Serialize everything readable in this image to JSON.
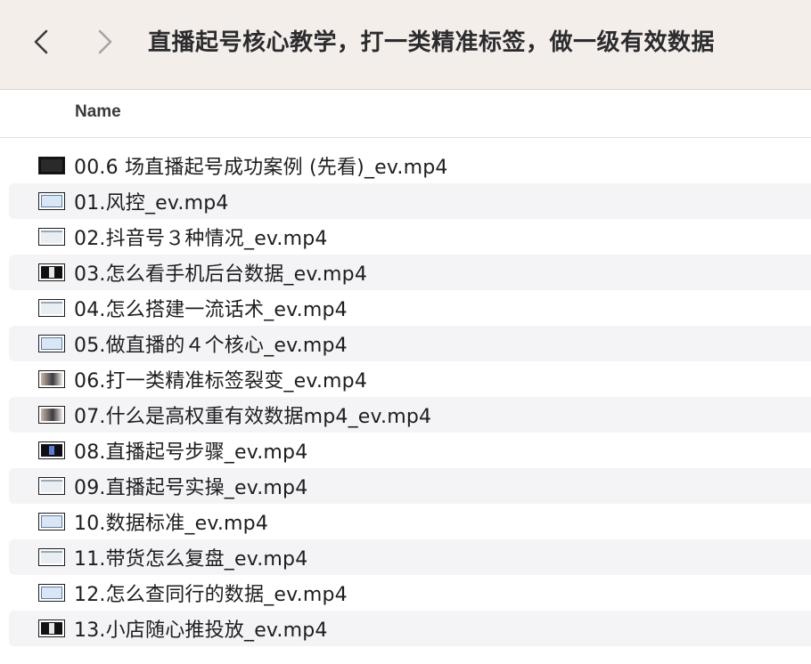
{
  "window": {
    "title": "直播起号核心教学，打一类精准标签，做一级有效数据",
    "back_icon": "chevron-left-icon",
    "forward_icon": "chevron-right-icon"
  },
  "columns": {
    "name": "Name"
  },
  "files": [
    {
      "name": "00.6 场直播起号成功案例 (先看)_ev.mp4",
      "thumb": "dark"
    },
    {
      "name": "01.风控_ev.mp4",
      "thumb": "blue"
    },
    {
      "name": "02.抖音号３种情况_ev.mp4",
      "thumb": "light"
    },
    {
      "name": "03.怎么看手机后台数据_ev.mp4",
      "thumb": "center"
    },
    {
      "name": "04.怎么搭建一流话术_ev.mp4",
      "thumb": "light"
    },
    {
      "name": "05.做直播的４个核心_ev.mp4",
      "thumb": "blue"
    },
    {
      "name": "06.打一类精准标签裂变_ev.mp4",
      "thumb": "person"
    },
    {
      "name": "07.什么是高权重有效数据mp4_ev.mp4",
      "thumb": "person"
    },
    {
      "name": "08.直播起号步骤_ev.mp4",
      "thumb": "centerblue"
    },
    {
      "name": "09.直播起号实操_ev.mp4",
      "thumb": "light"
    },
    {
      "name": "10.数据标准_ev.mp4",
      "thumb": "blue"
    },
    {
      "name": "11.带货怎么复盘_ev.mp4",
      "thumb": "light"
    },
    {
      "name": "12.怎么查同行的数据_ev.mp4",
      "thumb": "blue"
    },
    {
      "name": "13.小店随心推投放_ev.mp4",
      "thumb": "center"
    }
  ]
}
